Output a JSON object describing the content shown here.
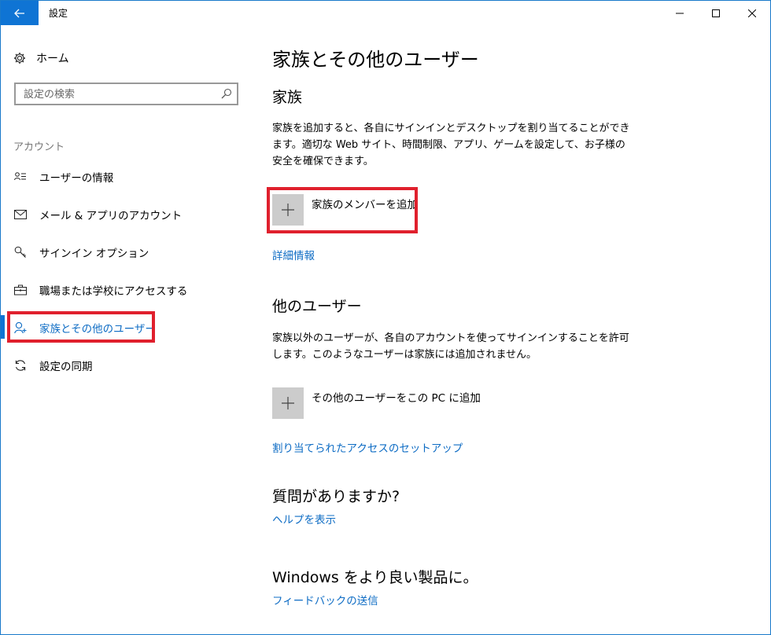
{
  "window": {
    "title": "設定"
  },
  "colors": {
    "accent": "#0f74d4",
    "link": "#0e6cc4",
    "highlight": "#e0202d",
    "tile": "#cccccc"
  },
  "sidebar": {
    "home_label": "ホーム",
    "search_placeholder": "設定の検索",
    "section_label": "アカウント",
    "items": [
      {
        "label": "ユーザーの情報",
        "icon": "user-info-icon"
      },
      {
        "label": "メール & アプリのアカウント",
        "icon": "mail-icon"
      },
      {
        "label": "サインイン オプション",
        "icon": "key-icon"
      },
      {
        "label": "職場または学校にアクセスする",
        "icon": "briefcase-icon"
      },
      {
        "label": "家族とその他のユーザー",
        "icon": "person-add-icon",
        "selected": true
      },
      {
        "label": "設定の同期",
        "icon": "sync-icon"
      }
    ]
  },
  "main": {
    "title": "家族とその他のユーザー",
    "family": {
      "heading": "家族",
      "description": "家族を追加すると、各自にサインインとデスクトップを割り当てることができます。適切な Web サイト、時間制限、アプリ、ゲームを設定して、お子様の安全を確保できます。",
      "add_label": "家族のメンバーを追加",
      "link": "詳細情報"
    },
    "others": {
      "heading": "他のユーザー",
      "description": "家族以外のユーザーが、各自のアカウントを使ってサインインすることを許可します。このようなユーザーは家族には追加されません。",
      "add_label": "その他のユーザーをこの PC に追加",
      "link": "割り当てられたアクセスのセットアップ"
    },
    "help": {
      "heading": "質問がありますか?",
      "link": "ヘルプを表示"
    },
    "feedback": {
      "heading": "Windows をより良い製品に。",
      "link": "フィードバックの送信"
    }
  }
}
